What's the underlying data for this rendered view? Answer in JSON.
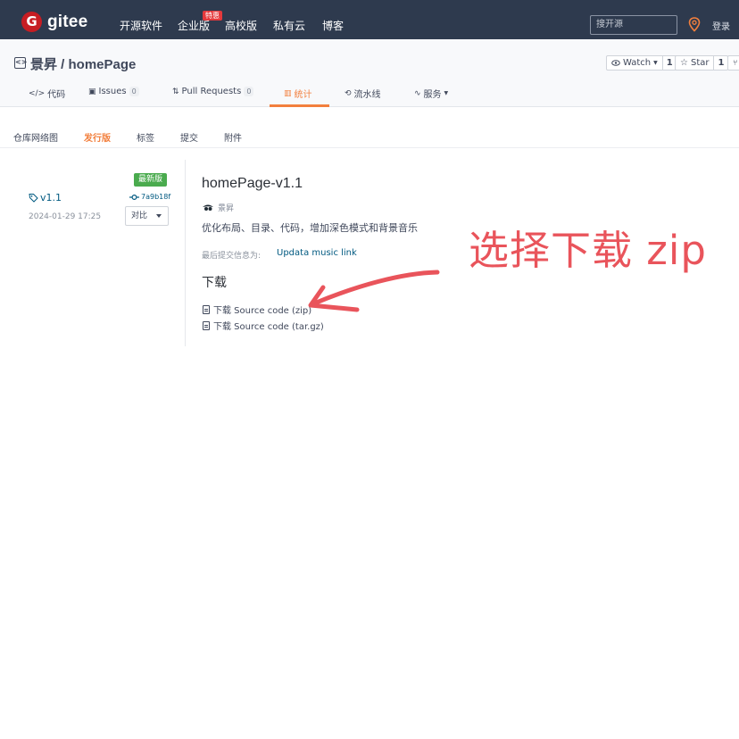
{
  "navbar": {
    "logo_mark": "G",
    "logo_text": "gitee",
    "links": [
      "开源软件",
      "企业版",
      "高校版",
      "私有云",
      "博客"
    ],
    "badge": "特惠",
    "search_placeholder": "搜开源",
    "login": "登录"
  },
  "repo": {
    "title": "景昇 / homePage",
    "watch_label": "Watch",
    "watch_count": "1",
    "star_label": "Star",
    "star_count": "1",
    "tabs": [
      {
        "label": "代码"
      },
      {
        "label": "Issues",
        "count": "0"
      },
      {
        "label": "Pull Requests",
        "count": "0"
      },
      {
        "label": "统计"
      },
      {
        "label": "流水线"
      },
      {
        "label": "服务"
      }
    ]
  },
  "subtabs": [
    "仓库网络图",
    "发行版",
    "标签",
    "提交",
    "附件"
  ],
  "release": {
    "latest_badge": "最新版",
    "tag": "v1.1",
    "commit": "7a9b18f",
    "date": "2024-01-29 17:25",
    "compare_label": "对比",
    "title": "homePage-v1.1",
    "author": "景昇",
    "description": "优化布局、目录、代码，增加深色模式和背景音乐",
    "last_commit_label": "最后提交信息为:",
    "last_commit_link": "Updata music link",
    "download_heading": "下载",
    "downloads": [
      "下载 Source code (zip)",
      "下载 Source code (tar.gz)"
    ]
  },
  "annotation": {
    "text": "选择下载 zip",
    "color": "#e9545b"
  },
  "colors": {
    "navbar_bg": "#2e3a4e",
    "accent": "#f27f3d",
    "link": "#005980",
    "brand_red": "#c71d23",
    "badge_green": "#4aab4e"
  }
}
